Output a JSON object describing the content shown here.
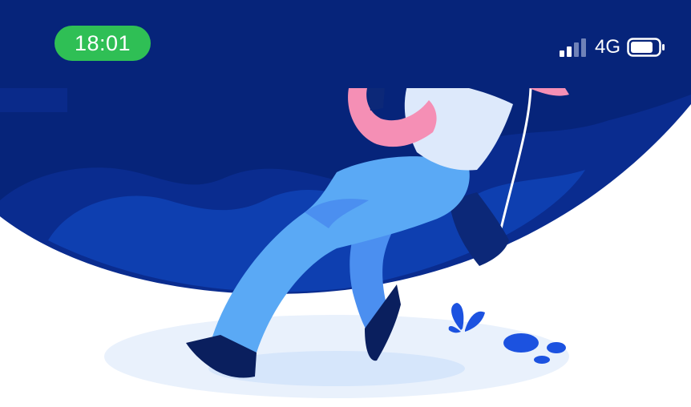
{
  "status_bar": {
    "time": "18:01",
    "network": "4G",
    "signal_icon": "cellular-signal-icon",
    "battery_icon": "battery-icon"
  },
  "illustration": {
    "icon": "person-walking-with-balloon-illustration",
    "colors": {
      "dark_navy": "#06247a",
      "night_blue": "#0a2c8f",
      "hill_blue": "#0e3fb0",
      "jeans_blue": "#5aa9f5",
      "shirt": "#dde9fb",
      "pink": "#f58fb5",
      "ground": "#e9f1fc"
    }
  }
}
